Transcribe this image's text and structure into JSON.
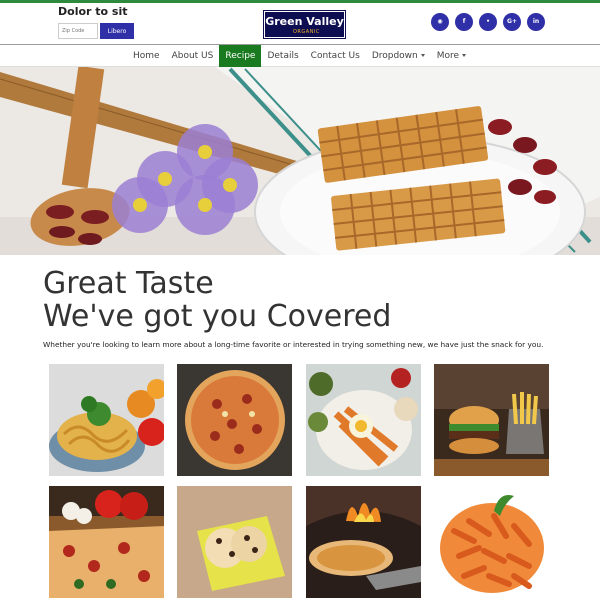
{
  "header": {
    "zip_title": "Dolor to sit",
    "zip_placeholder": "Zip Code",
    "zip_button": "Libero",
    "logo_main": "Green Valley",
    "logo_sub": "ORGANIC",
    "social_icons": [
      {
        "name": "rss-icon",
        "glyph": "◉"
      },
      {
        "name": "facebook-icon",
        "glyph": "f"
      },
      {
        "name": "twitter-icon",
        "glyph": "•"
      },
      {
        "name": "google-plus-icon",
        "glyph": "G+"
      },
      {
        "name": "linkedin-icon",
        "glyph": "in"
      }
    ]
  },
  "nav": {
    "items": [
      {
        "label": "Home"
      },
      {
        "label": "About US"
      },
      {
        "label": "Recipe",
        "active": true
      },
      {
        "label": "Details"
      },
      {
        "label": "Contact Us"
      },
      {
        "label": "Dropdown",
        "dropdown": true
      },
      {
        "label": "More",
        "dropdown": true
      }
    ]
  },
  "content": {
    "headline_line1": "Great Taste",
    "headline_line2": "We've got you Covered",
    "tagline": "Whether you're looking to learn more about a long-time favorite or interested in trying something new, we have just the snack for you."
  },
  "colors": {
    "accent": "#2f2fa8",
    "nav_active": "#1a7a1f",
    "logo_bg": "#0d0d52",
    "logo_sub": "#f0b429"
  },
  "gallery": [
    {
      "name": "spaghetti-photo"
    },
    {
      "name": "pizza-photo"
    },
    {
      "name": "salad-platter-photo"
    },
    {
      "name": "burger-fries-photo"
    },
    {
      "name": "pizza-slice-photo"
    },
    {
      "name": "cookies-photo"
    },
    {
      "name": "wood-fired-pizza-photo"
    },
    {
      "name": "penne-pasta-photo"
    }
  ]
}
